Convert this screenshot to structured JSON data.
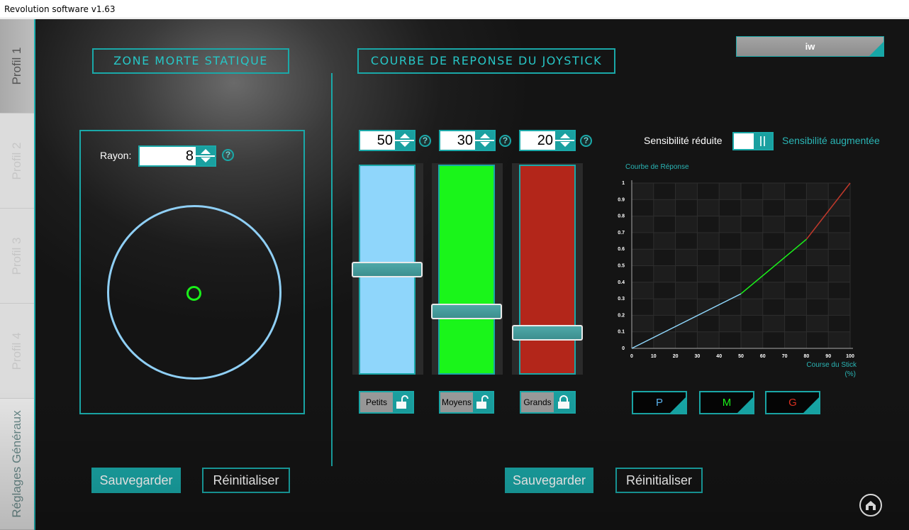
{
  "window": {
    "title": "Revolution software v1.63"
  },
  "tabs": [
    {
      "label": "Profil 1",
      "active": true
    },
    {
      "label": "Profil 2",
      "active": false
    },
    {
      "label": "Profil 3",
      "active": false
    },
    {
      "label": "Profil 4",
      "active": false
    },
    {
      "label": "Réglages Généraux",
      "active": false
    }
  ],
  "user_button": {
    "label": "iw"
  },
  "deadzone": {
    "header": "ZONE MORTE STATIQUE",
    "radius_label": "Rayon:",
    "radius_value": "8",
    "help": "?",
    "save_label": "Sauvegarder",
    "reset_label": "Réinitialiser"
  },
  "curve": {
    "header": "COURBE DE REPONSE DU JOYSTICK",
    "sliders": [
      {
        "name": "Petits",
        "value": "50",
        "color": "#8fd6fb",
        "locked": false,
        "level": 0.5
      },
      {
        "name": "Moyens",
        "value": "30",
        "color": "#1af51a",
        "locked": false,
        "level": 0.3
      },
      {
        "name": "Grands",
        "value": "20",
        "color": "#b3261a",
        "locked": true,
        "level": 0.2
      }
    ],
    "help": "?",
    "sens_left": "Sensibilité réduite",
    "sens_right": "Sensibilité augmentée",
    "pmg": [
      {
        "label": "P",
        "color": "#5ab4f0"
      },
      {
        "label": "M",
        "color": "#1af51a"
      },
      {
        "label": "G",
        "color": "#e03020"
      }
    ],
    "save_label": "Sauvegarder",
    "reset_label": "Réinitialiser"
  },
  "chart_data": {
    "type": "line",
    "title": "Courbe de Réponse",
    "xlabel": "Course du Stick",
    "xlabel_unit": "(%)",
    "ylabel": "",
    "xlim": [
      0,
      100
    ],
    "ylim": [
      0,
      1
    ],
    "xticks": [
      "0",
      "10",
      "20",
      "30",
      "40",
      "50",
      "60",
      "70",
      "80",
      "90",
      "100"
    ],
    "yticks": [
      "0",
      "0.1",
      "0.2",
      "0.3",
      "0.4",
      "0.5",
      "0.6",
      "0.7",
      "0.8",
      "0.9",
      "1"
    ],
    "grid": true,
    "series": [
      {
        "color": "#8fd6fb",
        "x": [
          0,
          50
        ],
        "y": [
          0,
          0.33
        ]
      },
      {
        "color": "#1af51a",
        "x": [
          50,
          80
        ],
        "y": [
          0.33,
          0.66
        ]
      },
      {
        "color": "#c0392b",
        "x": [
          80,
          100
        ],
        "y": [
          0.66,
          1
        ]
      }
    ]
  },
  "colors": {
    "accent": "#1aa8a8",
    "background": "#1a1a1a"
  }
}
